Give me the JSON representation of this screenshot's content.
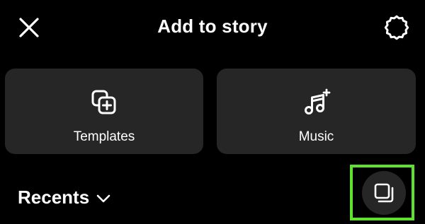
{
  "header": {
    "title": "Add to story",
    "close_icon": "close-icon",
    "settings_icon": "settings-gear-icon"
  },
  "options": [
    {
      "label": "Templates",
      "icon": "templates-icon"
    },
    {
      "label": "Music",
      "icon": "music-add-icon"
    }
  ],
  "gallery": {
    "recents_label": "Recents",
    "dropdown_icon": "chevron-down-icon",
    "multi_select_icon": "multi-select-icon"
  },
  "colors": {
    "background": "#000000",
    "card": "#262626",
    "highlight": "#5fe22d",
    "text": "#ffffff"
  }
}
